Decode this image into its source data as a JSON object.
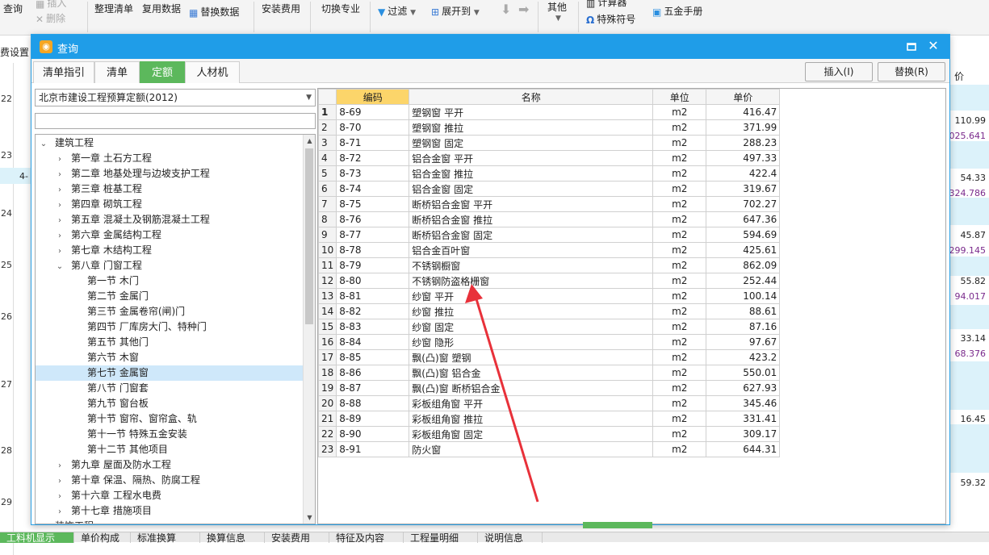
{
  "ribbon": {
    "query": "查询",
    "insert": "插入",
    "delete": "删除",
    "sort_list": "整理清单",
    "reuse_data": "复用数据",
    "replace_data": "替换数据",
    "install_fee": "安装费用",
    "switch_major": "切换专业",
    "filter": "过滤",
    "expand_to": "展开到",
    "other": "其他",
    "calculator": "计算器",
    "special_symbol": "特殊符号",
    "hardware_manual": "五金手册"
  },
  "sheet": {
    "fee_label": "费设置",
    "price_col": "价",
    "row_numbers": [
      "22",
      "23",
      "24",
      "25",
      "26",
      "27",
      "28",
      "29"
    ],
    "values": [
      {
        "v": "110.99",
        "purple": false
      },
      {
        "v": "025.641",
        "purple": true
      },
      {
        "v": "54.33",
        "purple": false
      },
      {
        "v": "324.786",
        "purple": true
      },
      {
        "v": "45.87",
        "purple": false
      },
      {
        "v": "299.145",
        "purple": true
      },
      {
        "v": "55.82",
        "purple": false
      },
      {
        "v": "94.017",
        "purple": true
      },
      {
        "v": "33.14",
        "purple": false
      },
      {
        "v": "68.376",
        "purple": true
      },
      {
        "v": "16.45",
        "purple": false
      },
      {
        "v": "59.32",
        "purple": false
      }
    ],
    "cell_text": "4-"
  },
  "bottom_tabs": [
    "工料机显示",
    "单价构成",
    "标准换算",
    "换算信息",
    "安装费用",
    "特征及内容",
    "工程量明细",
    "说明信息"
  ],
  "dialog": {
    "title": "查询",
    "tabs": [
      "清单指引",
      "清单",
      "定额",
      "人材机"
    ],
    "active_tab": 2,
    "insert_button": "插入(I)",
    "replace_button": "替换(R)",
    "library": "北京市建设工程预算定额(2012)",
    "search_value": "",
    "tree": [
      {
        "label": "建筑工程",
        "level": 0,
        "expanded": true
      },
      {
        "label": "第一章 土石方工程",
        "level": 1,
        "expanded": false
      },
      {
        "label": "第二章 地基处理与边坡支护工程",
        "level": 1,
        "expanded": false
      },
      {
        "label": "第三章 桩基工程",
        "level": 1,
        "expanded": false
      },
      {
        "label": "第四章 砌筑工程",
        "level": 1,
        "expanded": false
      },
      {
        "label": "第五章 混凝土及钢筋混凝土工程",
        "level": 1,
        "expanded": false
      },
      {
        "label": "第六章 金属结构工程",
        "level": 1,
        "expanded": false
      },
      {
        "label": "第七章 木结构工程",
        "level": 1,
        "expanded": false
      },
      {
        "label": "第八章 门窗工程",
        "level": 1,
        "expanded": true
      },
      {
        "label": "第一节 木门",
        "level": 2
      },
      {
        "label": "第二节 金属门",
        "level": 2
      },
      {
        "label": "第三节 金属卷帘(闸)门",
        "level": 2
      },
      {
        "label": "第四节 厂库房大门、特种门",
        "level": 2
      },
      {
        "label": "第五节 其他门",
        "level": 2
      },
      {
        "label": "第六节 木窗",
        "level": 2
      },
      {
        "label": "第七节 金属窗",
        "level": 2,
        "selected": true
      },
      {
        "label": "第八节 门窗套",
        "level": 2
      },
      {
        "label": "第九节 窗台板",
        "level": 2
      },
      {
        "label": "第十节 窗帘、窗帘盒、轨",
        "level": 2
      },
      {
        "label": "第十一节 特殊五金安装",
        "level": 2
      },
      {
        "label": "第十二节 其他项目",
        "level": 2
      },
      {
        "label": "第九章 屋面及防水工程",
        "level": 1,
        "expanded": false
      },
      {
        "label": "第十章 保温、隔热、防腐工程",
        "level": 1,
        "expanded": false
      },
      {
        "label": "第十六章 工程水电费",
        "level": 1,
        "expanded": false
      },
      {
        "label": "第十七章 措施项目",
        "level": 1,
        "expanded": false
      },
      {
        "label": "装饰工程",
        "level": 0,
        "expanded": true
      }
    ],
    "grid": {
      "headers": [
        "",
        "编码",
        "名称",
        "单位",
        "单价"
      ],
      "rows": [
        [
          "1",
          "8-69",
          "塑钢窗 平开",
          "m2",
          "416.47"
        ],
        [
          "2",
          "8-70",
          "塑钢窗 推拉",
          "m2",
          "371.99"
        ],
        [
          "3",
          "8-71",
          "塑钢窗 固定",
          "m2",
          "288.23"
        ],
        [
          "4",
          "8-72",
          "铝合金窗 平开",
          "m2",
          "497.33"
        ],
        [
          "5",
          "8-73",
          "铝合金窗 推拉",
          "m2",
          "422.4"
        ],
        [
          "6",
          "8-74",
          "铝合金窗 固定",
          "m2",
          "319.67"
        ],
        [
          "7",
          "8-75",
          "断桥铝合金窗 平开",
          "m2",
          "702.27"
        ],
        [
          "8",
          "8-76",
          "断桥铝合金窗 推拉",
          "m2",
          "647.36"
        ],
        [
          "9",
          "8-77",
          "断桥铝合金窗 固定",
          "m2",
          "594.69"
        ],
        [
          "10",
          "8-78",
          "铝合金百叶窗",
          "m2",
          "425.61"
        ],
        [
          "11",
          "8-79",
          "不锈钢橱窗",
          "m2",
          "862.09"
        ],
        [
          "12",
          "8-80",
          "不锈钢防盗格栅窗",
          "m2",
          "252.44"
        ],
        [
          "13",
          "8-81",
          "纱窗 平开",
          "m2",
          "100.14"
        ],
        [
          "14",
          "8-82",
          "纱窗 推拉",
          "m2",
          "88.61"
        ],
        [
          "15",
          "8-83",
          "纱窗 固定",
          "m2",
          "87.16"
        ],
        [
          "16",
          "8-84",
          "纱窗 隐形",
          "m2",
          "97.67"
        ],
        [
          "17",
          "8-85",
          "飘(凸)窗 塑钢",
          "m2",
          "423.2"
        ],
        [
          "18",
          "8-86",
          "飘(凸)窗 铝合金",
          "m2",
          "550.01"
        ],
        [
          "19",
          "8-87",
          "飘(凸)窗 断桥铝合金",
          "m2",
          "627.93"
        ],
        [
          "20",
          "8-88",
          "彩板组角窗 平开",
          "m2",
          "345.46"
        ],
        [
          "21",
          "8-89",
          "彩板组角窗 推拉",
          "m2",
          "331.41"
        ],
        [
          "22",
          "8-90",
          "彩板组角窗 固定",
          "m2",
          "309.17"
        ],
        [
          "23",
          "8-91",
          "防火窗",
          "m2",
          "644.31"
        ]
      ]
    }
  },
  "colors": {
    "title_bar": "#1f9de8",
    "active_tab": "#5cb85c",
    "header_code": "#fcd56a",
    "selected": "#cfe8fa",
    "annotation": "#e8313a"
  }
}
